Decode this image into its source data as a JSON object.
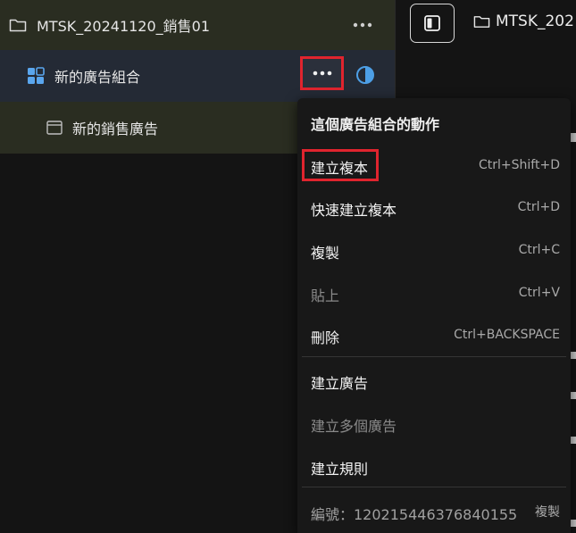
{
  "tree": {
    "campaign": {
      "name": "MTSK_20241120_銷售01",
      "icon": "folder-icon",
      "more_icon": "more-horizontal-icon"
    },
    "adset": {
      "name": "新的廣告組合",
      "icon": "adset-grid-icon",
      "more_icon": "more-horizontal-icon",
      "status_icon": "half-circle-icon"
    },
    "ad": {
      "name": "新的銷售廣告",
      "icon": "ad-window-icon"
    }
  },
  "topbar": {
    "toggle_icon": "sidebar-toggle-icon",
    "crumb": "MTSK_202"
  },
  "menu": {
    "title": "這個廣告組合的動作",
    "items": [
      {
        "label": "建立複本",
        "shortcut": "Ctrl+Shift+D",
        "disabled": false
      },
      {
        "label": "快速建立複本",
        "shortcut": "Ctrl+D",
        "disabled": false
      },
      {
        "label": "複製",
        "shortcut": "Ctrl+C",
        "disabled": false
      },
      {
        "label": "貼上",
        "shortcut": "Ctrl+V",
        "disabled": true
      },
      {
        "label": "刪除",
        "shortcut": "Ctrl+BACKSPACE",
        "disabled": false
      },
      {
        "label": "建立廣告",
        "shortcut": "",
        "disabled": false
      },
      {
        "label": "建立多個廣告",
        "shortcut": "",
        "disabled": true
      },
      {
        "label": "建立規則",
        "shortcut": "",
        "disabled": false
      }
    ],
    "id_label": "編號：120215446376840155",
    "copy_label": "複製"
  },
  "colors": {
    "highlight": "#e0242e",
    "adset_icon": "#5aa6ee",
    "status_icon": "#4d9fe6"
  }
}
